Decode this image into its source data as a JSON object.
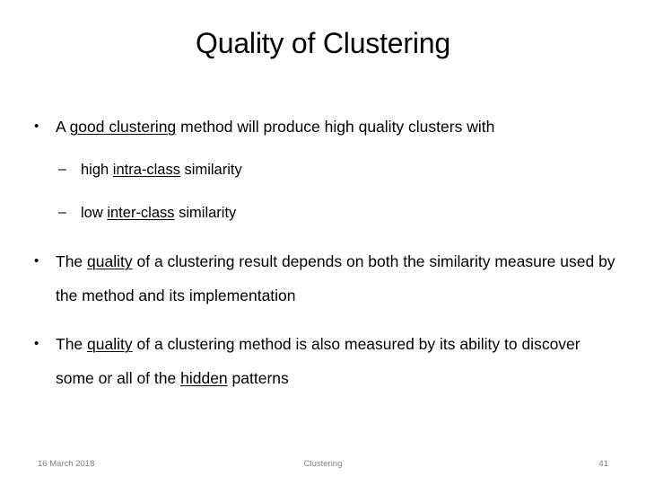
{
  "slide": {
    "title": "Quality of Clustering",
    "background_color": "#ffffff",
    "text_color": "#000000",
    "footer_color": "#808080"
  },
  "content": {
    "bullets": [
      {
        "marker": "•",
        "segments": [
          {
            "text": "A ",
            "underline": false
          },
          {
            "text": "good clustering",
            "underline": true
          },
          {
            "text": " method will produce high quality clusters with",
            "underline": false
          }
        ],
        "sub_bullets": [
          {
            "marker": "–",
            "segments": [
              {
                "text": "high ",
                "underline": false
              },
              {
                "text": "intra-class",
                "underline": true
              },
              {
                "text": " similarity",
                "underline": false
              }
            ]
          },
          {
            "marker": "–",
            "segments": [
              {
                "text": "low ",
                "underline": false
              },
              {
                "text": "inter-class",
                "underline": true
              },
              {
                "text": " similarity",
                "underline": false
              }
            ]
          }
        ]
      },
      {
        "marker": "•",
        "segments": [
          {
            "text": "The ",
            "underline": false
          },
          {
            "text": "quality",
            "underline": true
          },
          {
            "text": " of a clustering result depends on both the similarity measure used by the method and its implementation",
            "underline": false
          }
        ],
        "sub_bullets": []
      },
      {
        "marker": "•",
        "segments": [
          {
            "text": "The ",
            "underline": false
          },
          {
            "text": "quality",
            "underline": true
          },
          {
            "text": " of a clustering method is also measured by its ability to discover some or all of the ",
            "underline": false
          },
          {
            "text": "hidden",
            "underline": true
          },
          {
            "text": " patterns",
            "underline": false
          }
        ],
        "sub_bullets": []
      }
    ]
  },
  "footer": {
    "date": "16 March 2018",
    "center_label": "Clustering",
    "page_number": "41"
  }
}
